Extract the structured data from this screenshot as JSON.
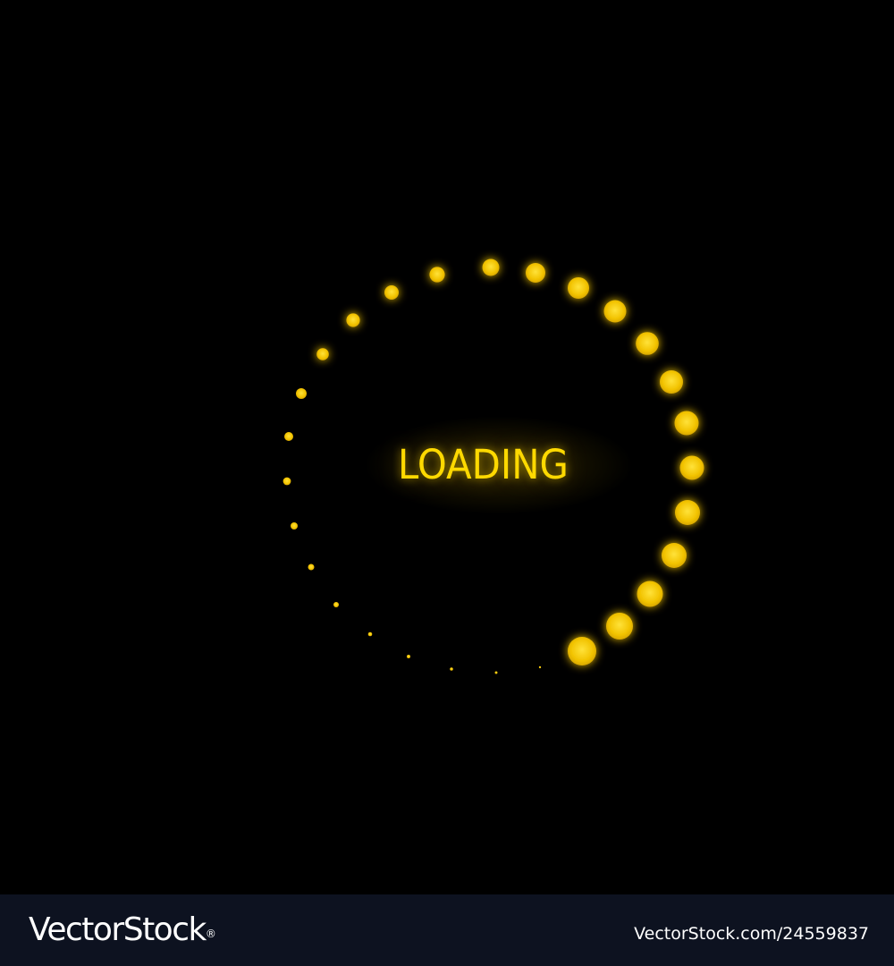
{
  "loader": {
    "label": "LOADING",
    "accent_color": "#ffd900",
    "glow_color": "#ffc400",
    "background_color": "#000000"
  },
  "footer": {
    "brand": "VectorStock",
    "brand_mark": "®",
    "image_id": "VectorStock.com/24559837",
    "background_color": "#0d1220"
  }
}
